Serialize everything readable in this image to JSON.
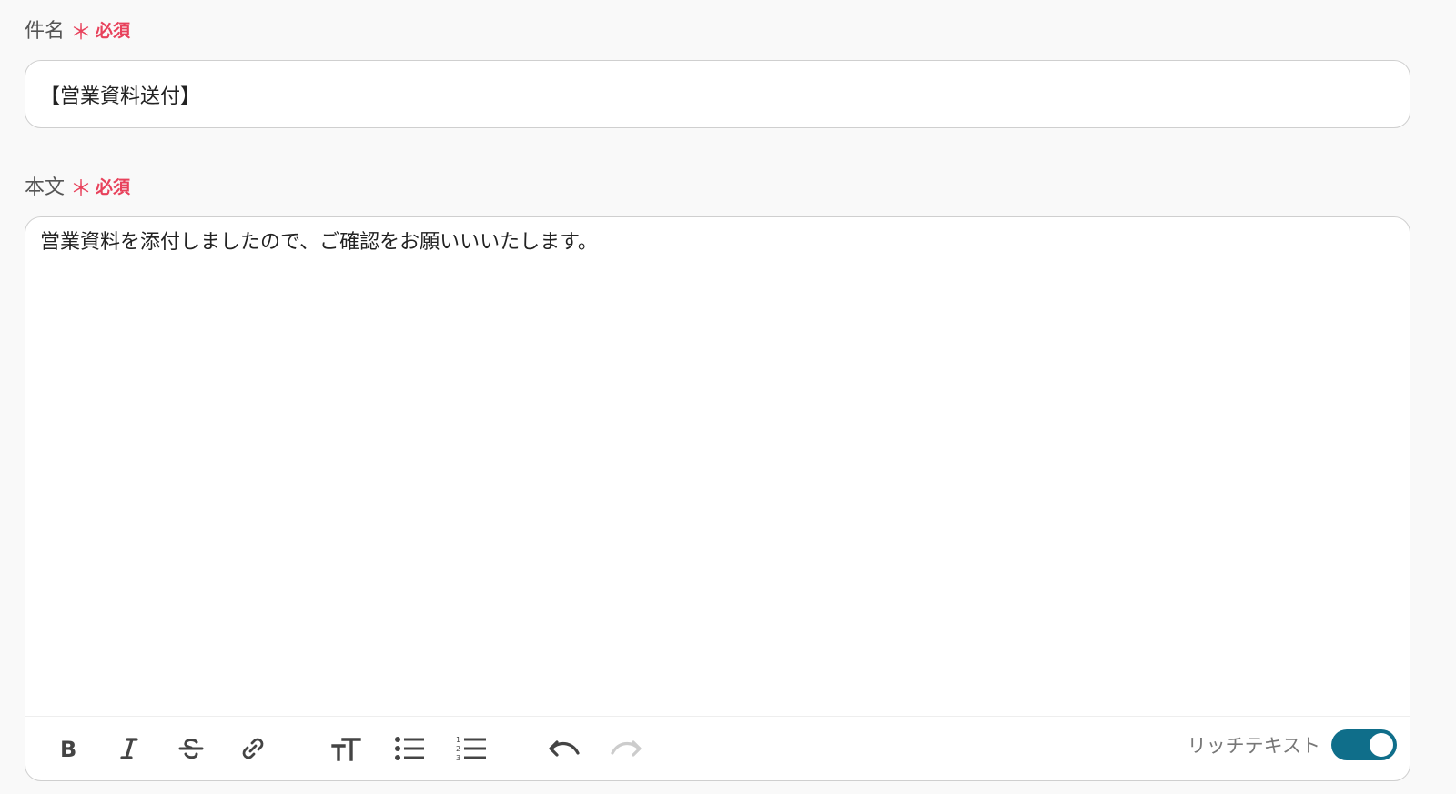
{
  "subject": {
    "label": "件名",
    "asterisk": "＊",
    "required": "必須",
    "value": "【営業資料送付】"
  },
  "body": {
    "label": "本文",
    "asterisk": "＊",
    "required": "必須",
    "value": "営業資料を添付しましたので、ご確認をお願いいいたします。"
  },
  "toolbar": {
    "icons": [
      "bold-icon",
      "italic-icon",
      "strikethrough-icon",
      "link-icon",
      "text-size-icon",
      "bullet-list-icon",
      "numbered-list-icon",
      "undo-icon",
      "redo-icon"
    ],
    "rich_text_label": "リッチテキスト",
    "rich_text_enabled": true
  },
  "colors": {
    "required": "#e8425c",
    "toggle": "#0f6e8a",
    "border": "#cfcfcf"
  }
}
